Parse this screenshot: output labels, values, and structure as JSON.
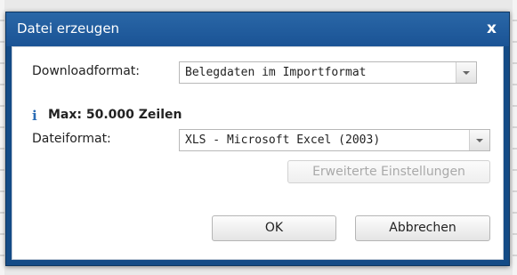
{
  "dialog": {
    "title": "Datei erzeugen",
    "close_glyph": "x",
    "download_format": {
      "label": "Downloadformat:",
      "value": "Belegdaten im Importformat"
    },
    "info": {
      "icon": "i",
      "text": "Max: 50.000 Zeilen"
    },
    "file_format": {
      "label": "Dateiformat:",
      "value": "XLS - Microsoft Excel (2003)"
    },
    "advanced_settings_label": "Erweiterte Einstellungen",
    "ok_label": "OK",
    "cancel_label": "Abbrechen"
  },
  "colors": {
    "title_bar": "#1a5395",
    "info_icon": "#2a6cb5",
    "disabled_text": "#a9a9a9"
  }
}
